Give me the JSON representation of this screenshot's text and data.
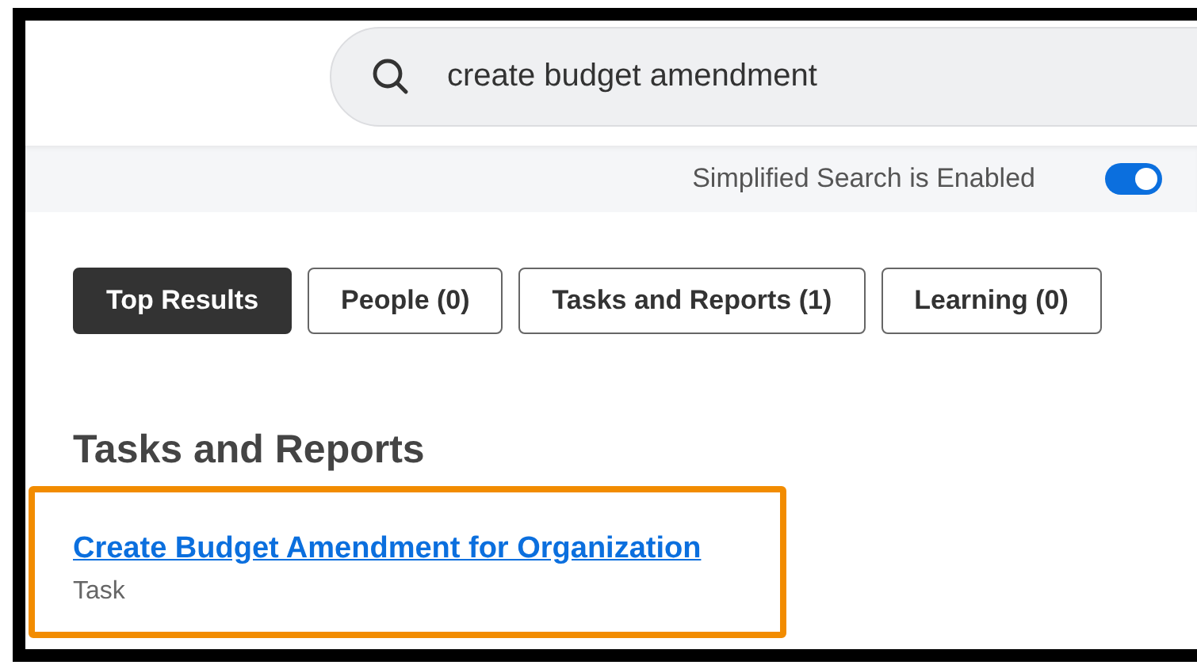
{
  "search": {
    "value": "create budget amendment"
  },
  "simplified_search": {
    "label": "Simplified Search is Enabled",
    "on": true
  },
  "tabs": [
    {
      "label": "Top Results",
      "selected": true
    },
    {
      "label": "People (0)",
      "selected": false
    },
    {
      "label": "Tasks and Reports (1)",
      "selected": false
    },
    {
      "label": "Learning (0)",
      "selected": false
    }
  ],
  "section": {
    "title": "Tasks and Reports",
    "results": [
      {
        "title": "Create Budget Amendment for Organization",
        "type": "Task",
        "highlighted": true
      }
    ]
  }
}
